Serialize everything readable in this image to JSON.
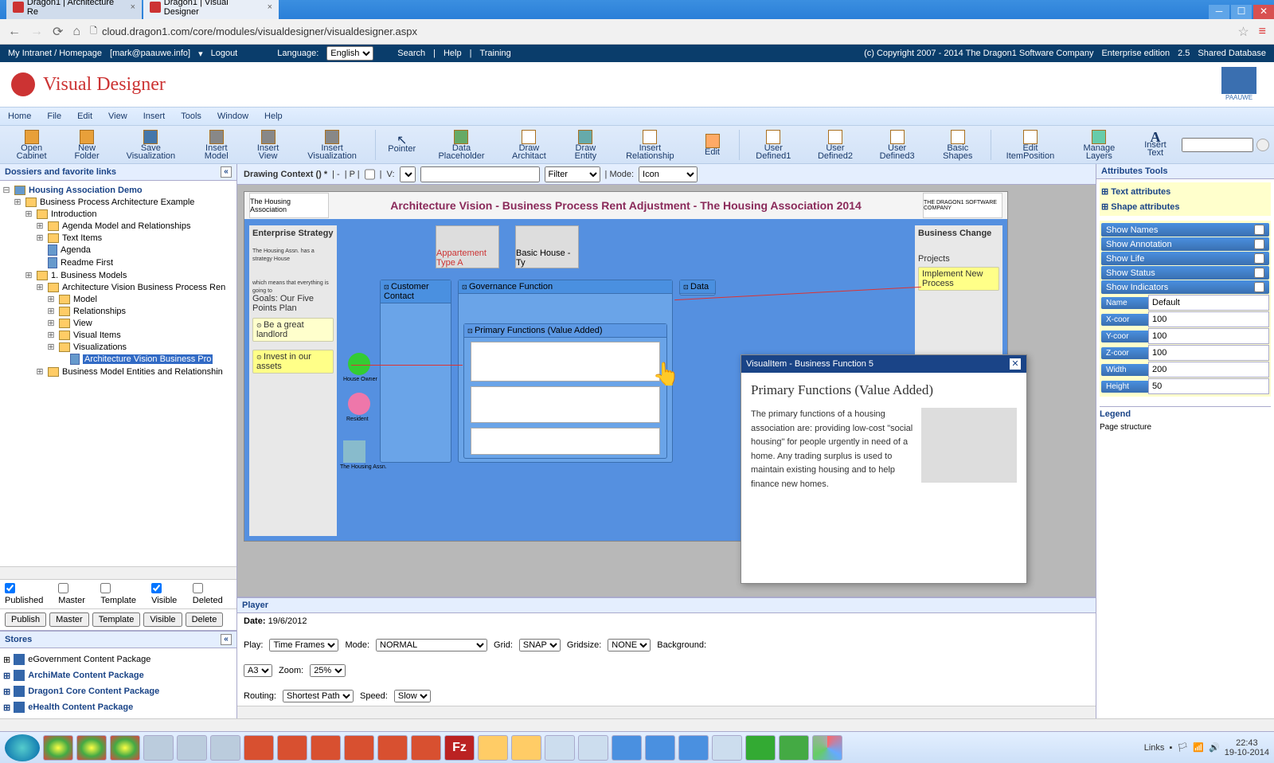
{
  "browser": {
    "tabs": [
      {
        "title": "Dragon1 | Architecture Re"
      },
      {
        "title": "Dragon1 | Visual Designer"
      }
    ],
    "url": "cloud.dragon1.com/core/modules/visualdesigner/visualdesigner.aspx"
  },
  "topbar": {
    "intranet": "My Intranet / Homepage",
    "user": "[mark@paauwe.info]",
    "logout": "Logout",
    "language_label": "Language:",
    "language": "English",
    "search": "Search",
    "help": "Help",
    "training": "Training",
    "copyright": "(c) Copyright 2007 - 2014 The Dragon1 Software Company",
    "edition": "Enterprise edition",
    "version": "2.5",
    "db": "Shared Database"
  },
  "app_title": "Visual Designer",
  "client_logo_text": "PAAUWE",
  "menu": [
    "Home",
    "File",
    "Edit",
    "View",
    "Insert",
    "Tools",
    "Window",
    "Help"
  ],
  "ribbon": [
    "Open Cabinet",
    "New Folder",
    "Save Visualization",
    "Insert Model",
    "Insert View",
    "Insert Visualization",
    "Pointer",
    "Data Placeholder",
    "Draw Architact",
    "Draw Entity",
    "Insert Relationship",
    "Edit",
    "User Defined1",
    "User Defined2",
    "User Defined3",
    "Basic Shapes",
    "Edit ItemPosition",
    "Manage Layers",
    "Insert Text"
  ],
  "dossiers": {
    "title": "Dossiers and favorite links",
    "root": "Housing Association Demo",
    "items": [
      {
        "label": "Business Process Architecture Example",
        "indent": 1,
        "type": "folder"
      },
      {
        "label": "Introduction",
        "indent": 2,
        "type": "folder"
      },
      {
        "label": "Agenda Model and Relationships",
        "indent": 3,
        "type": "folder"
      },
      {
        "label": "Text Items",
        "indent": 3,
        "type": "folder"
      },
      {
        "label": "Agenda",
        "indent": 3,
        "type": "doc"
      },
      {
        "label": "Readme First",
        "indent": 3,
        "type": "doc"
      },
      {
        "label": "1. Business Models",
        "indent": 2,
        "type": "folder"
      },
      {
        "label": "Architecture Vision Business Process Ren",
        "indent": 3,
        "type": "folder"
      },
      {
        "label": "Model",
        "indent": 4,
        "type": "folder"
      },
      {
        "label": "Relationships",
        "indent": 4,
        "type": "folder"
      },
      {
        "label": "View",
        "indent": 4,
        "type": "folder"
      },
      {
        "label": "Visual Items",
        "indent": 4,
        "type": "folder"
      },
      {
        "label": "Visualizations",
        "indent": 4,
        "type": "folder"
      },
      {
        "label": "Architecture Vision Business Pro",
        "indent": 5,
        "type": "doc",
        "selected": true
      },
      {
        "label": "Business Model Entities and Relationshin",
        "indent": 3,
        "type": "folder"
      }
    ],
    "checks": {
      "published": {
        "label": "Published",
        "checked": true
      },
      "master": {
        "label": "Master",
        "checked": false
      },
      "template": {
        "label": "Template",
        "checked": false
      },
      "visible": {
        "label": "Visible",
        "checked": true
      },
      "deleted": {
        "label": "Deleted",
        "checked": false
      }
    },
    "buttons": [
      "Publish",
      "Master",
      "Template",
      "Visible",
      "Delete"
    ]
  },
  "stores": {
    "title": "Stores",
    "items": [
      "eGovernment Content Package",
      "ArchiMate Content Package",
      "Dragon1 Core Content Package",
      "eHealth Content Package"
    ]
  },
  "context_bar": {
    "label": "Drawing Context () *",
    "filter_label": "Filter",
    "mode_label": "| Mode:",
    "mode": "Icon",
    "p_label": "| P |",
    "v_label": "V:",
    "mid_text": "| - "
  },
  "canvas": {
    "title": "Architecture Vision - Business Process Rent Adjustment - The Housing Association 2014",
    "left_logo": "The Housing Association",
    "right_logo": "THE DRAGON1 SOFTWARE COMPANY",
    "left_panel_title": "Enterprise Strategy",
    "left_panel_sub": "The Housing Assn. has a strategy House",
    "left_panel_goals": "which means that everything is going to",
    "left_panel_goals2": "Goals: Our Five Points Plan",
    "left_tags": [
      "Be a great landlord",
      "Invest in our assets"
    ],
    "right_panel_title": "Business Change",
    "right_panel_sub": "Projects",
    "right_tag": "Implement New Process",
    "apt_a": "Appartement Type A",
    "apt_b": "Basic House - Ty",
    "box1_head": "Customer Contact",
    "box2_head": "Governance Function",
    "box3_head": "Data",
    "inner_head": "Primary Functions (Value Added)",
    "actors": [
      "House Owner",
      "Resident",
      "The Housing Assn."
    ]
  },
  "popup": {
    "header": "VisualItem - Business Function 5",
    "title": "Primary Functions (Value Added)",
    "body": "The primary functions of a housing association are: providing low-cost \"social housing\" for people urgently in need of a home. Any trading surplus is used to maintain existing housing and to help finance new homes."
  },
  "player": {
    "title": "Player",
    "date_label": "Date:",
    "date": "19/6/2012",
    "play_label": "Play:",
    "play": "Time Frames",
    "mode_label": "Mode:",
    "mode": "NORMAL",
    "grid_label": "Grid:",
    "grid": "SNAP",
    "gridsize_label": "Gridsize:",
    "gridsize": "NONE",
    "bg_label": "Background:",
    "paper": "A3",
    "zoom_label": "Zoom:",
    "zoom": "25%",
    "routing_label": "Routing:",
    "routing": "Shortest Path",
    "speed_label": "Speed:",
    "speed": "Slow"
  },
  "attributes": {
    "title": "Attributes Tools",
    "text_attr": "Text attributes",
    "shape_attr": "Shape attributes",
    "toggles": [
      "Show Names",
      "Show Annotation",
      "Show Life",
      "Show Status",
      "Show Indicators"
    ],
    "fields": {
      "name": {
        "label": "Name",
        "value": "Default"
      },
      "xcoor": {
        "label": "X-coor",
        "value": "100"
      },
      "ycoor": {
        "label": "Y-coor",
        "value": "100"
      },
      "zcoor": {
        "label": "Z-coor",
        "value": "100"
      },
      "width": {
        "label": "Width",
        "value": "200"
      },
      "height": {
        "label": "Height",
        "value": "50"
      }
    },
    "legend": "Legend",
    "page_structure": "Page structure"
  },
  "taskbar": {
    "links": "Links",
    "time": "22:43",
    "date": "19-10-2014"
  }
}
